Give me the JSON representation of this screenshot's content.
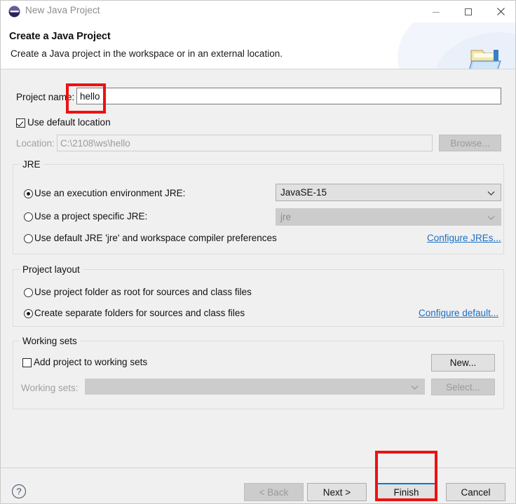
{
  "window": {
    "title": "New Java Project",
    "icon": "eclipse-logo-icon",
    "minimize_label": "Minimize",
    "maximize_label": "Maximize",
    "close_label": "Close"
  },
  "header": {
    "title": "Create a Java Project",
    "description": "Create a Java project in the workspace or in an external location.",
    "icon": "java-project-folder-icon"
  },
  "form": {
    "project_name_label": "Project name:",
    "project_name_value": "hello",
    "project_name_placeholder": "",
    "use_default_location_label": "Use default location",
    "use_default_location_checked": true,
    "location_label": "Location:",
    "location_value": "C:\\2108\\ws\\hello",
    "browse_label": "Browse...",
    "browse_enabled": false
  },
  "jre": {
    "group_title": "JRE",
    "option_execution_env": "Use an execution environment JRE:",
    "option_project_specific": "Use a project specific JRE:",
    "option_default_jre": "Use default JRE 'jre' and workspace compiler preferences",
    "selected": "execution_env",
    "execution_env_value": "JavaSE-15",
    "project_jre_value": "jre",
    "configure_link": "Configure JREs..."
  },
  "project_layout": {
    "group_title": "Project layout",
    "option_root_folder": "Use project folder as root for sources and class files",
    "option_separate_folders": "Create separate folders for sources and class files",
    "selected": "separate_folders",
    "configure_link": "Configure default..."
  },
  "working_sets": {
    "group_title": "Working sets",
    "add_checkbox_label": "Add project to working sets",
    "add_checkbox_checked": false,
    "working_sets_label": "Working sets:",
    "working_sets_value": "",
    "new_label": "New...",
    "new_enabled": true,
    "select_label": "Select...",
    "select_enabled": false
  },
  "footer": {
    "help_label": "?",
    "back_label": "< Back",
    "back_enabled": false,
    "next_label": "Next >",
    "next_enabled": true,
    "finish_label": "Finish",
    "finish_is_default": true,
    "cancel_label": "Cancel"
  },
  "annotations": {
    "highlight_color": "#ee1111",
    "project_name_highlight": "project-name-field",
    "finish_highlight": "finish-button"
  },
  "colors": {
    "accent_blue": "#0078d7",
    "link_blue": "#1a6fc4",
    "dialog_bg": "#f0f0f0",
    "annotation_red": "#ee1111"
  }
}
